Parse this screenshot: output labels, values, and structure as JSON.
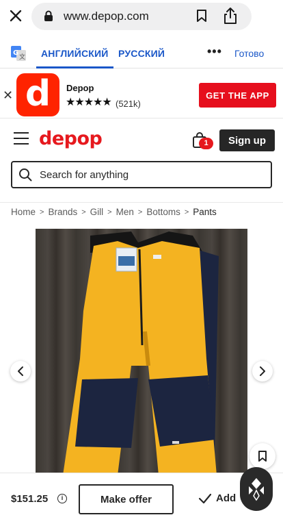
{
  "browser": {
    "url": "www.depop.com"
  },
  "translate": {
    "source_lang": "АНГЛИЙСКИЙ",
    "target_lang": "РУССКИЙ",
    "more": "•••",
    "done": "Готово"
  },
  "app_banner": {
    "icon_letter": "d",
    "app_name": "Depop",
    "stars": "★★★★★",
    "rating_count": "(521k)",
    "cta": "GET THE APP"
  },
  "header": {
    "logo": "depop",
    "cart_count": "1",
    "signup_label": "Sign up"
  },
  "search": {
    "placeholder": "Search for anything"
  },
  "breadcrumb": {
    "items": [
      "Home",
      "Brands",
      "Gill",
      "Men",
      "Bottoms",
      "Pants"
    ]
  },
  "product": {
    "price": "$151.25",
    "offer_label": "Make offer",
    "add_label": "Add"
  },
  "colors": {
    "brand_red": "#e6191e",
    "link_blue": "#1a57c8",
    "product_yellow": "#f4b321",
    "product_navy": "#1c2540"
  }
}
